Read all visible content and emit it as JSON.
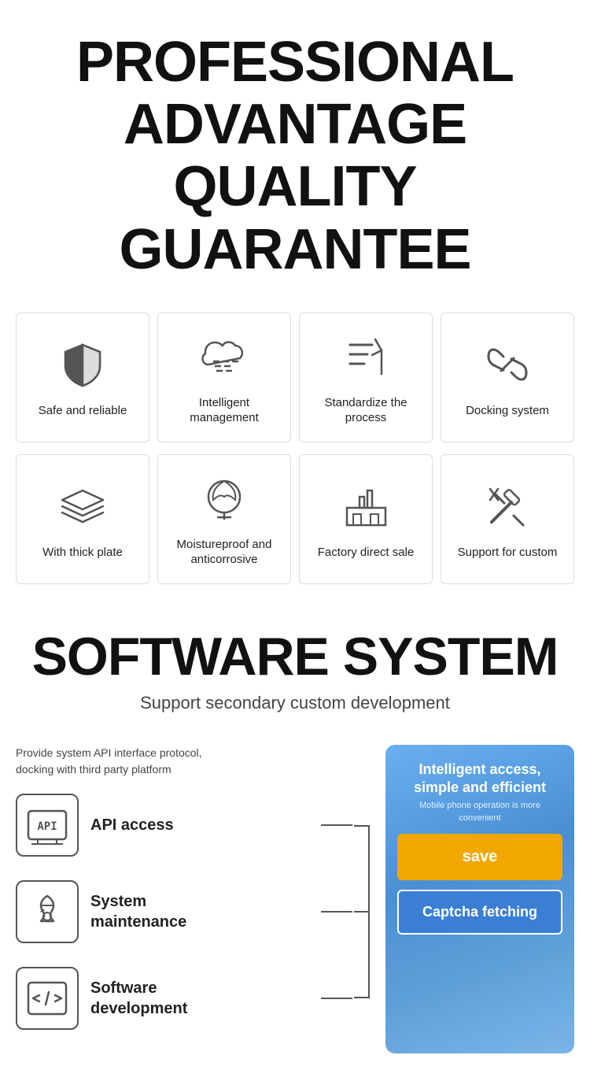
{
  "header": {
    "line1": "PROFESSIONAL",
    "line2": "ADVANTAGE",
    "line3": "QUALITY GUARANTEE"
  },
  "row1_cards": [
    {
      "label": "Safe and reliable"
    },
    {
      "label": "Intelligent management"
    },
    {
      "label": "Standardize the process"
    },
    {
      "label": "Docking system"
    }
  ],
  "row2_cards": [
    {
      "label": "With thick plate"
    },
    {
      "label": "Moistureproof and anticorrosive"
    },
    {
      "label": "Factory direct sale"
    },
    {
      "label": "Support for custom"
    }
  ],
  "software": {
    "title": "SOFTWARE SYSTEM",
    "subtitle": "Support secondary custom development",
    "provide_text": "Provide system API interface protocol,\ndocking with third party platform"
  },
  "features": [
    {
      "label": "API access"
    },
    {
      "label": "System\nmaintenance"
    },
    {
      "label": "Software\ndevelopment"
    }
  ],
  "phone_card": {
    "main_label": "Intelligent access, simple and efficient",
    "sub_label": "Mobile phone operation is more convenient",
    "btn_save": "save",
    "btn_captcha": "Captcha fetching"
  }
}
